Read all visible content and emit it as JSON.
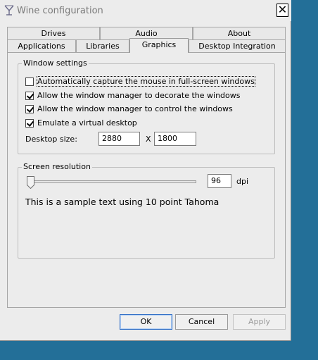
{
  "window": {
    "title": "Wine configuration"
  },
  "tabs_top": [
    "Drives",
    "Audio",
    "About"
  ],
  "tabs_bottom": [
    "Applications",
    "Libraries",
    "Graphics",
    "Desktop Integration"
  ],
  "active_tab": "Graphics",
  "window_settings": {
    "title": "Window settings",
    "options": [
      {
        "label": "Automatically capture the mouse in full-screen windows",
        "checked": false
      },
      {
        "label": "Allow the window manager to decorate the windows",
        "checked": true
      },
      {
        "label": "Allow the window manager to control the windows",
        "checked": true
      },
      {
        "label": "Emulate a virtual desktop",
        "checked": true
      }
    ],
    "desktop_size_label": "Desktop size:",
    "desktop_width": "2880",
    "desktop_height": "1800",
    "separator": "X"
  },
  "screen_resolution": {
    "title": "Screen resolution",
    "dpi_value": "96",
    "dpi_unit": "dpi",
    "slider_fraction": 0.0,
    "sample_text": "This is a sample text using 10 point Tahoma"
  },
  "buttons": {
    "ok": "OK",
    "cancel": "Cancel",
    "apply": "Apply"
  },
  "colors": {
    "desktop_background": "#236f98",
    "default_button_border": "#2f6ec7"
  }
}
